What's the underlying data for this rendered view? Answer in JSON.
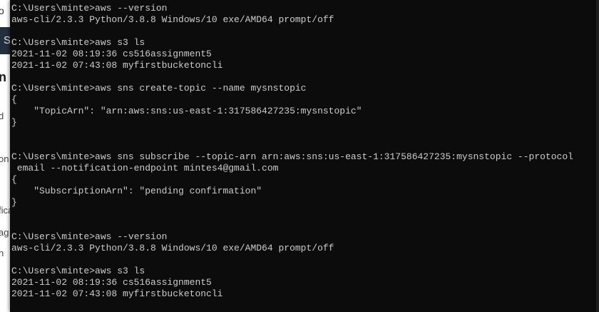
{
  "background_window": {
    "fragments": [
      "o",
      "S",
      "n S",
      "d",
      "on",
      "fica",
      "ag",
      "n"
    ]
  },
  "console": {
    "lines": [
      "C:\\Users\\minte>aws --version",
      "aws-cli/2.3.3 Python/3.8.8 Windows/10 exe/AMD64 prompt/off",
      "",
      "C:\\Users\\minte>aws s3 ls",
      "2021-11-02 08:19:36 cs516assignment5",
      "2021-11-02 07:43:08 myfirstbucketoncli",
      "",
      "C:\\Users\\minte>aws sns create-topic --name mysnstopic",
      "{",
      "    \"TopicArn\": \"arn:aws:sns:us-east-1:317586427235:mysnstopic\"",
      "}",
      "",
      "",
      "C:\\Users\\minte>aws sns subscribe --topic-arn arn:aws:sns:us-east-1:317586427235:mysnstopic --protocol",
      " email --notification-endpoint mintes4@gmail.com",
      "{",
      "    \"SubscriptionArn\": \"pending confirmation\"",
      "}",
      "",
      "",
      "C:\\Users\\minte>aws --version",
      "aws-cli/2.3.3 Python/3.8.8 Windows/10 exe/AMD64 prompt/off",
      "",
      "C:\\Users\\minte>aws s3 ls",
      "2021-11-02 08:19:36 cs516assignment5",
      "2021-11-02 07:43:08 myfirstbucketoncli"
    ]
  }
}
